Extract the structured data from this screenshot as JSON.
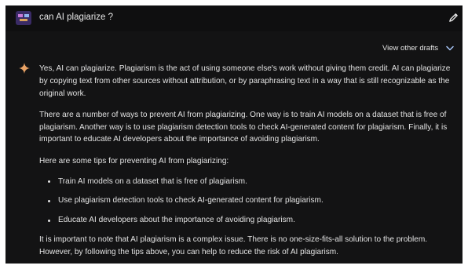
{
  "prompt": {
    "text": "can AI plagiarize ?",
    "avatar_icon": "user-avatar",
    "edit_icon": "pencil-icon"
  },
  "drafts": {
    "label": "View other drafts",
    "icon": "chevron-down-icon"
  },
  "response": {
    "icon": "gemini-sparkle-icon",
    "accent": "#e8a265",
    "paragraph_1": "Yes, AI can plagiarize. Plagiarism is the act of using someone else's work without giving them credit. AI can plagiarize by copying text from other sources without attribution, or by paraphrasing text in a way that is still recognizable as the original work.",
    "paragraph_2": "There are a number of ways to prevent AI from plagiarizing. One way is to train AI models on a dataset that is free of plagiarism. Another way is to use plagiarism detection tools to check AI-generated content for plagiarism. Finally, it is important to educate AI developers about the importance of avoiding plagiarism.",
    "paragraph_3": "Here are some tips for preventing AI from plagiarizing:",
    "tips": [
      "Train AI models on a dataset that is free of plagiarism.",
      "Use plagiarism detection tools to check AI-generated content for plagiarism.",
      "Educate AI developers about the importance of avoiding plagiarism."
    ],
    "paragraph_4": "It is important to note that AI plagiarism is a complex issue. There is no one-size-fits-all solution to the problem. However, by following the tips above, you can help to reduce the risk of AI plagiarism."
  },
  "colors": {
    "background": "#131314",
    "prompt_bar": "#0f0f10",
    "text": "#e3e3e3"
  }
}
